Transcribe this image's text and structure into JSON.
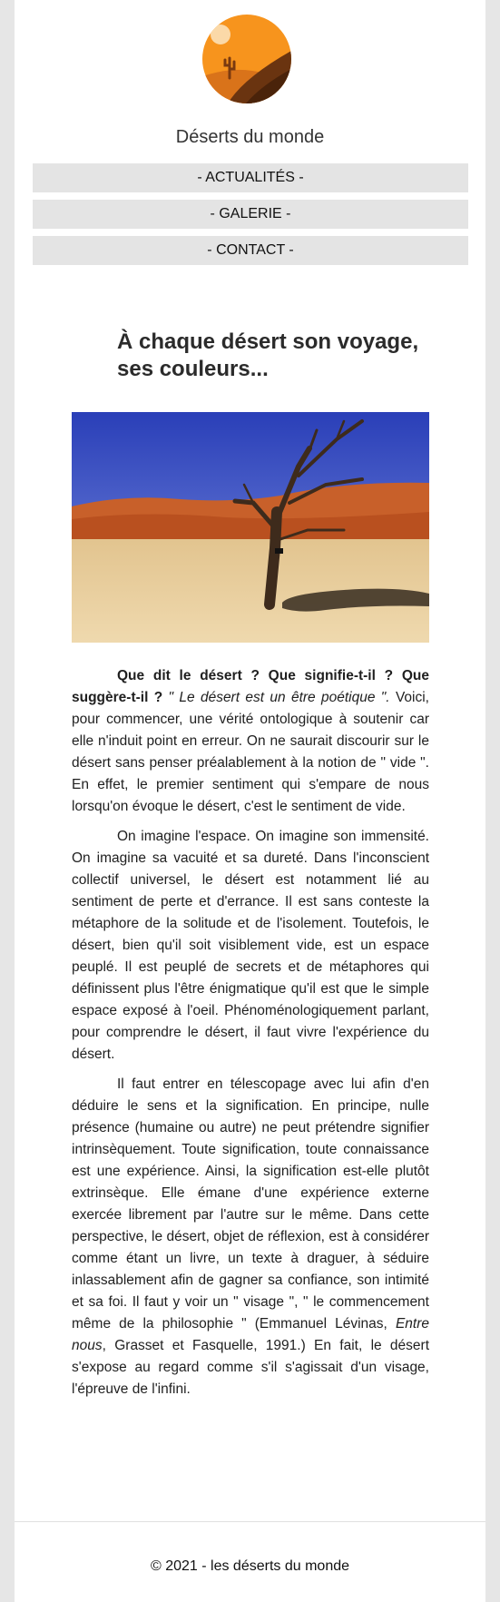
{
  "site": {
    "title": "Déserts du monde"
  },
  "nav": [
    {
      "label": "- ACTUALITÉS -"
    },
    {
      "label": "- GALERIE -"
    },
    {
      "label": "- CONTACT -"
    }
  ],
  "main": {
    "headline": "À chaque désert son voyage, ses couleurs...",
    "paragraphs": {
      "p1": {
        "bold": "Que dit le désert ? Que signifie-t-il ? Que suggère-t-il ?",
        "italic": " \" Le désert est un être poétique \".",
        "rest": " Voici, pour commencer, une vérité ontologique à soutenir car elle n'induit point en erreur. On ne saurait discourir sur le désert sans penser préalablement à la notion de \" vide \". En effet, le premier sentiment qui s'empare de nous lorsqu'on évoque le désert, c'est le sentiment de vide."
      },
      "p2": "On imagine l'espace. On imagine son immensité. On imagine sa vacuité et sa dureté. Dans l'inconscient collectif universel, le désert est notamment lié au sentiment de perte et d'errance. Il est sans conteste la métaphore de la solitude et de l'isolement. Toutefois, le désert, bien qu'il soit visiblement vide, est un espace peuplé. Il est peuplé de secrets et de métaphores qui définissent plus l'être énigmatique qu'il est que le simple espace exposé à l'oeil. Phénoménologiquement parlant, pour comprendre le désert, il faut vivre l'expérience du désert.",
      "p3": {
        "a": "Il faut entrer en télescopage avec lui afin d'en déduire le sens et la signification. En principe, nulle présence (humaine ou autre) ne peut prétendre signifier intrinsèquement. Toute signification, toute connaissance est une expérience. Ainsi, la signification est-elle plutôt extrinsèque. Elle émane d'une expérience externe exercée librement par l'autre sur le même. Dans cette perspective, le désert, objet de réflexion, est à considérer comme étant un livre, un texte à draguer, à séduire inlassablement afin de gagner sa confiance, son intimité et sa foi. Il faut y voir un \" visage \", \" le commencement même de la philosophie \" (Emmanuel Lévinas, ",
        "italic": "Entre nous",
        "b": ", Grasset et Fasquelle, 1991.) En fait, le désert s'expose au regard comme s'il s'agissait d'un visage, l'épreuve de l'infini."
      }
    }
  },
  "footer": {
    "text": "© 2021 - les déserts du monde"
  },
  "colors": {
    "logo_orange": "#f6921e",
    "logo_dark": "#5a2a0a",
    "nav_bg": "#e4e4e4",
    "page_bg": "#e6e6e6"
  }
}
